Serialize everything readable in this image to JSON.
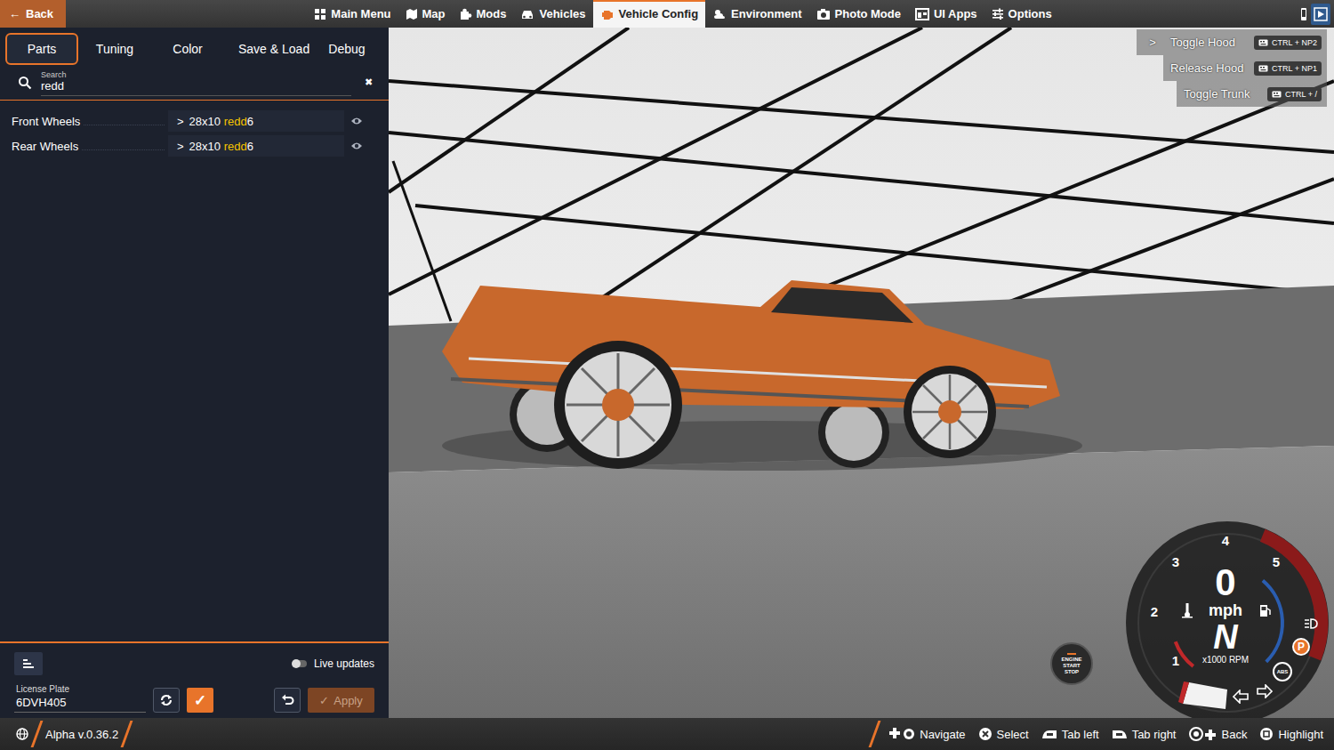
{
  "top_menu": {
    "back": {
      "icon": "←",
      "label": "Back"
    },
    "items": [
      {
        "label": "Main Menu",
        "selected": false
      },
      {
        "label": "Map",
        "selected": false
      },
      {
        "label": "Mods",
        "selected": false
      },
      {
        "label": "Vehicles",
        "selected": false
      },
      {
        "label": "Vehicle Config",
        "selected": true
      },
      {
        "label": "Environment",
        "selected": false
      },
      {
        "label": "Photo Mode",
        "selected": false
      },
      {
        "label": "UI Apps",
        "selected": false
      },
      {
        "label": "Options",
        "selected": false
      }
    ]
  },
  "config_tabs": [
    {
      "label": "Parts",
      "selected": true
    },
    {
      "label": "Tuning",
      "selected": false
    },
    {
      "label": "Color",
      "selected": false
    },
    {
      "label": "Save & Load",
      "selected": false
    },
    {
      "label": "Debug",
      "selected": false
    }
  ],
  "search": {
    "label": "Search",
    "value": "redd",
    "clear": "✖"
  },
  "parts": [
    {
      "slot": "Front Wheels",
      "expander": ">",
      "value": [
        {
          "text": "28x10 ",
          "match": false
        },
        {
          "text": "redd",
          "match": true
        },
        {
          "text": "6",
          "match": false
        }
      ],
      "visible": true
    },
    {
      "slot": "Rear Wheels",
      "expander": ">",
      "value": [
        {
          "text": "28x10 ",
          "match": false
        },
        {
          "text": "redd",
          "match": true
        },
        {
          "text": "6",
          "match": false
        }
      ],
      "visible": true
    }
  ],
  "live_updates": {
    "label": "Live updates",
    "on": false
  },
  "license_plate": {
    "label": "License Plate",
    "value": "6DVH405"
  },
  "confirm_button": "✓",
  "apply_button": {
    "icon": "✓",
    "label": "Apply",
    "disabled": true
  },
  "keybindings": {
    "toggle": ">",
    "items": [
      {
        "action": "Toggle Hood",
        "keys": "CTRL + NP2"
      },
      {
        "action": "Release Hood",
        "keys": "CTRL + NP1"
      },
      {
        "action": "Toggle Trunk",
        "keys": "CTRL + /"
      }
    ]
  },
  "engine_button": [
    "ENGINE",
    "START",
    "STOP"
  ],
  "gauge": {
    "ticks": [
      "1",
      "2",
      "3",
      "4",
      "5"
    ],
    "speed": "0",
    "unit": "mph",
    "gear": "N",
    "rpm_label": "x1000 RPM",
    "parking_brake": {
      "label": "P",
      "on": true
    },
    "abs": {
      "label": "ABS",
      "on": false
    }
  },
  "status_bar": {
    "version": "Alpha v.0.36.2",
    "hints": [
      "Navigate",
      "Select",
      "Tab left",
      "Tab right",
      "Back",
      "Highlight"
    ]
  }
}
